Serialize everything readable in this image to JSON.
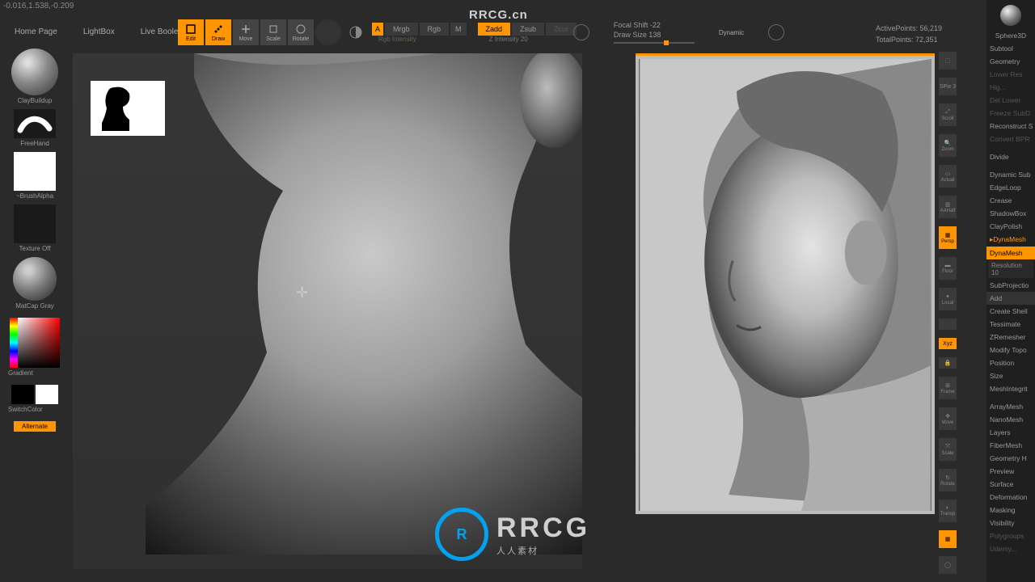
{
  "coords": "-0.016,1.538,-0.209",
  "menu": {
    "home": "Home Page",
    "lightbox": "LightBox",
    "liveboolean": "Live Boolean"
  },
  "tools": {
    "edit": "Edit",
    "draw": "Draw",
    "move": "Move",
    "scale": "Scale",
    "rotate": "Rotate"
  },
  "modes": {
    "mrgb": "Mrgb",
    "rgb": "Rgb",
    "m": "M",
    "zadd": "Zadd",
    "zsub": "Zsub",
    "zcut": "Zcut",
    "rgb_intensity": "Rgb Intensity",
    "z_intensity": "Z Intensity 20"
  },
  "sliders": {
    "focal_label": "Focal Shift -22",
    "draw_label": "Draw Size 138",
    "dynamic": "Dynamic"
  },
  "stats": {
    "active": "ActivePoints: 56,219",
    "total": "TotalPoints: 72,351"
  },
  "left": {
    "brush": "ClayBuildup",
    "stroke": "FreeHand",
    "alpha": "~BrushAlpha",
    "texture": "Texture Off",
    "material": "MatCap Gray",
    "gradient": "Gradient",
    "switch": "SwitchColor",
    "alternate": "Alternate"
  },
  "righticons": {
    "splt": "SPix 3",
    "zoom": "Zoom",
    "actual": "Actual",
    "aahalf": "AAHalf",
    "persp": "Persp",
    "floor": "Floor",
    "local": "Local",
    "lock": "Lock",
    "frame": "Frame",
    "move": "Move",
    "scale": "Scale",
    "rot": "Rotate",
    "transp": "Transp",
    "xyz": "Xyz"
  },
  "panel": {
    "header": "Sphere3D",
    "items1": [
      "Subtool",
      "Geometry"
    ],
    "dim1": [
      "Lower Res",
      "Hig...",
      "Del Lower",
      "Freeze SubD"
    ],
    "items2": [
      "Reconstruct S"
    ],
    "dim2": [
      "Convert BPR"
    ],
    "items3": [
      "Divide",
      "Dynamic Sub",
      "EdgeLoop",
      "Crease",
      "ShadowBox",
      "ClayPolish"
    ],
    "dynamesh_h": "▸DynaMesh",
    "dynamesh_btn": "DynaMesh",
    "res": "Resolution 10",
    "subproj": "SubProjectio",
    "add": "Add",
    "create": "Create Shell",
    "items4": [
      "Tessimate",
      "ZRemesher",
      "Modify Topo",
      "Position",
      "Size",
      "MeshIntegrit"
    ],
    "items5": [
      "ArrayMesh",
      "NanoMesh",
      "Layers",
      "FiberMesh",
      "Geometry H",
      "Preview",
      "Surface",
      "Deformation",
      "Masking",
      "Visibility",
      "Polygroups",
      "Udemy..."
    ]
  },
  "watermark": {
    "top": "RRCG.cn",
    "name": "RRCG",
    "sub": "人人素材"
  }
}
